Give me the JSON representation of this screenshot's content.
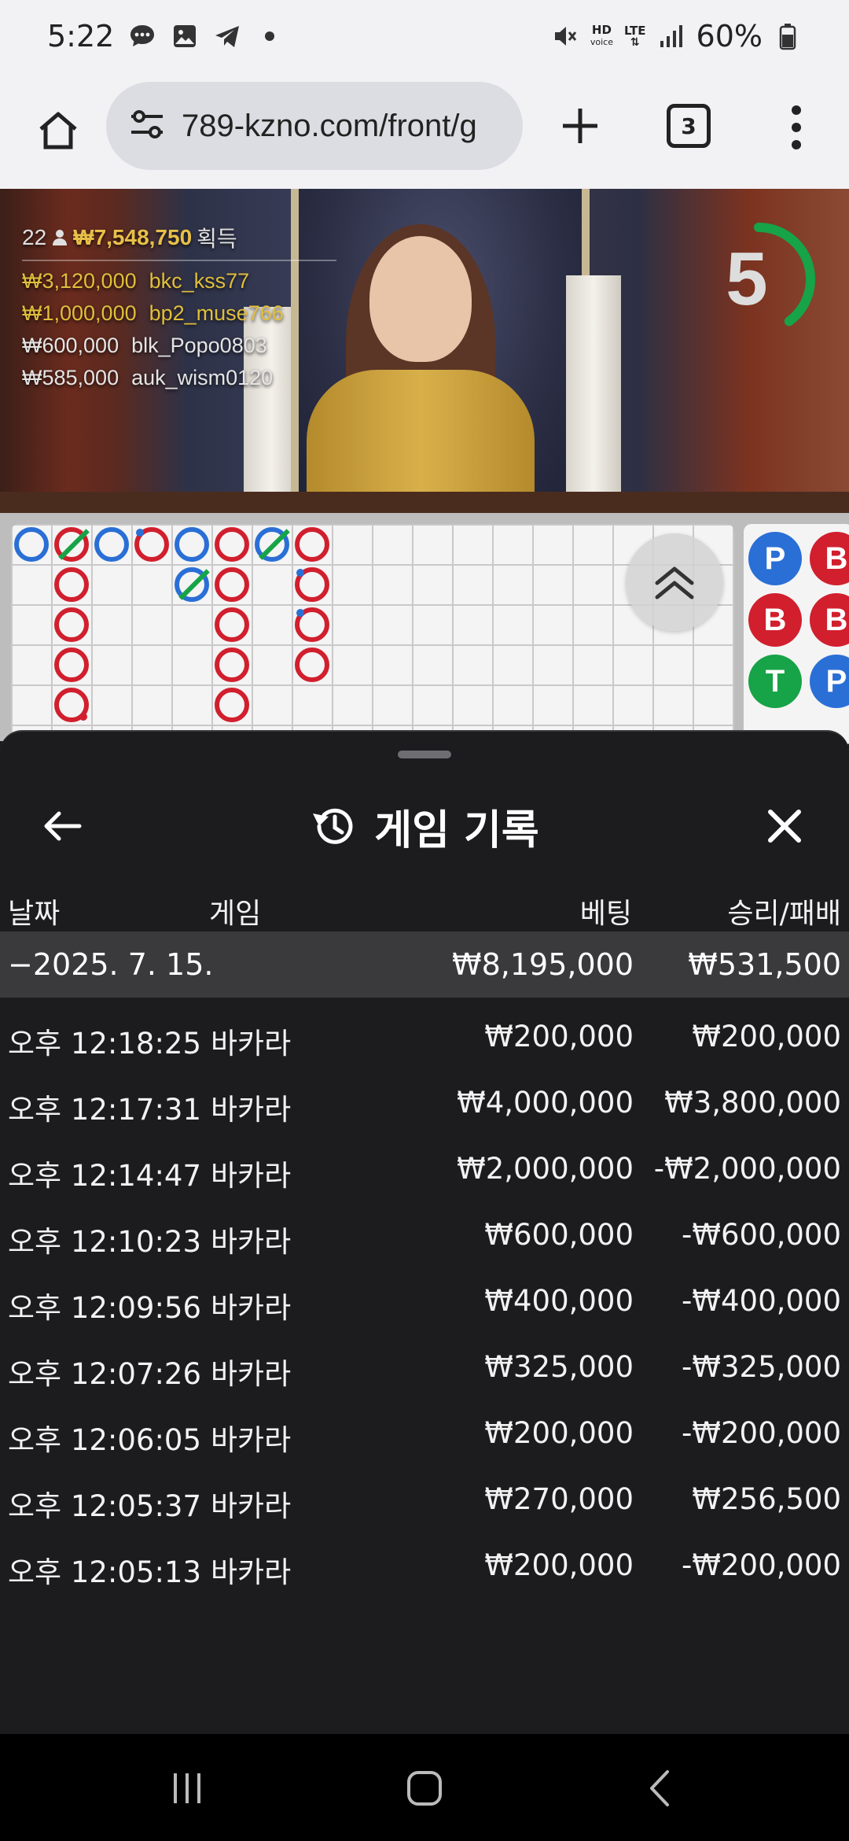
{
  "status_bar": {
    "time": "5:22",
    "battery": "60%",
    "hd_label": "HD",
    "voice_label": "voice",
    "lte_label": "LTE"
  },
  "browser": {
    "url": "789-kzno.com/front/g",
    "tab_count": "3"
  },
  "live": {
    "countdown": "5",
    "countdown_fraction": 0.4,
    "winner_count": "22",
    "winner_total": "₩7,548,750",
    "winner_total_suffix": "획득",
    "winners": [
      {
        "amount": "₩3,120,000",
        "user": "bkc_kss77"
      },
      {
        "amount": "₩1,000,000",
        "user": "bp2_muse766"
      },
      {
        "amount": "₩600,000",
        "user": "blk_Popo0803"
      },
      {
        "amount": "₩585,000",
        "user": "auk_wism0120"
      }
    ]
  },
  "side_panel": {
    "pills": [
      "P",
      "B",
      "B",
      "B",
      "T",
      "P"
    ]
  },
  "history": {
    "title": "게임 기록",
    "columns": {
      "date": "날짜",
      "game": "게임",
      "bet": "베팅",
      "win_loss": "승리/패배"
    },
    "day": {
      "date": "−2025. 7. 15.",
      "bet": "₩8,195,000",
      "win_loss": "₩531,500"
    },
    "records": [
      {
        "time": "오후 12:18:25",
        "game": "바카라",
        "bet": "₩200,000",
        "win_loss": "₩200,000"
      },
      {
        "time": "오후 12:17:31",
        "game": "바카라",
        "bet": "₩4,000,000",
        "win_loss": "₩3,800,000"
      },
      {
        "time": "오후 12:14:47",
        "game": "바카라",
        "bet": "₩2,000,000",
        "win_loss": "-₩2,000,000"
      },
      {
        "time": "오후 12:10:23",
        "game": "바카라",
        "bet": "₩600,000",
        "win_loss": "-₩600,000"
      },
      {
        "time": "오후 12:09:56",
        "game": "바카라",
        "bet": "₩400,000",
        "win_loss": "-₩400,000"
      },
      {
        "time": "오후 12:07:26",
        "game": "바카라",
        "bet": "₩325,000",
        "win_loss": "-₩325,000"
      },
      {
        "time": "오후 12:06:05",
        "game": "바카라",
        "bet": "₩200,000",
        "win_loss": "-₩200,000"
      },
      {
        "time": "오후 12:05:37",
        "game": "바카라",
        "bet": "₩270,000",
        "win_loss": "₩256,500"
      },
      {
        "time": "오후 12:05:13",
        "game": "바카라",
        "bet": "₩200,000",
        "win_loss": "-₩200,000"
      }
    ]
  },
  "colors": {
    "banker": "#d11f2e",
    "player": "#2a6fd6",
    "tie": "#17a347",
    "winner_gold": "#e0be3c",
    "timer_ring": "#17a347"
  }
}
